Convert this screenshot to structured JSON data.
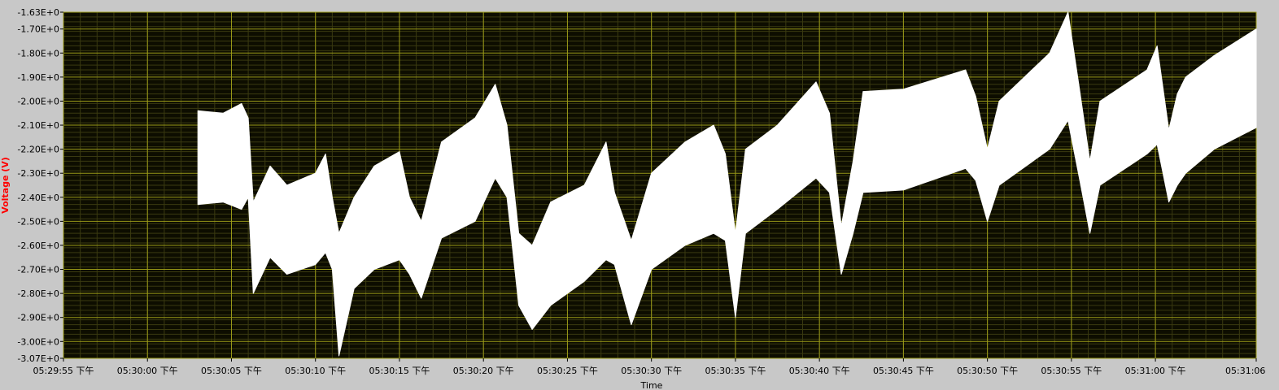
{
  "chart_data": {
    "type": "line",
    "xlabel": "Time",
    "ylabel": "Voltage (V)",
    "xlim": [
      "05:29:55",
      "05:31:06"
    ],
    "ylim": [
      -3.07,
      -1.63
    ],
    "grid": true,
    "yticks": [
      {
        "value": -1.63,
        "label": "-1.63E+0"
      },
      {
        "value": -1.7,
        "label": "-1.70E+0"
      },
      {
        "value": -1.8,
        "label": "-1.80E+0"
      },
      {
        "value": -1.9,
        "label": "-1.90E+0"
      },
      {
        "value": -2.0,
        "label": "-2.00E+0"
      },
      {
        "value": -2.1,
        "label": "-2.10E+0"
      },
      {
        "value": -2.2,
        "label": "-2.20E+0"
      },
      {
        "value": -2.3,
        "label": "-2.30E+0"
      },
      {
        "value": -2.4,
        "label": "-2.40E+0"
      },
      {
        "value": -2.5,
        "label": "-2.50E+0"
      },
      {
        "value": -2.6,
        "label": "-2.60E+0"
      },
      {
        "value": -2.7,
        "label": "-2.70E+0"
      },
      {
        "value": -2.8,
        "label": "-2.80E+0"
      },
      {
        "value": -2.9,
        "label": "-2.90E+0"
      },
      {
        "value": -3.0,
        "label": "-3.00E+0"
      },
      {
        "value": -3.07,
        "label": "-3.07E+0"
      }
    ],
    "xticks": [
      {
        "value": 0,
        "label": "05:29:55 下午"
      },
      {
        "value": 5,
        "label": "05:30:00 下午"
      },
      {
        "value": 10,
        "label": "05:30:05 下午"
      },
      {
        "value": 15,
        "label": "05:30:10 下午"
      },
      {
        "value": 20,
        "label": "05:30:15 下午"
      },
      {
        "value": 25,
        "label": "05:30:20 下午"
      },
      {
        "value": 30,
        "label": "05:30:25 下午"
      },
      {
        "value": 35,
        "label": "05:30:30 下午"
      },
      {
        "value": 40,
        "label": "05:30:35 下午"
      },
      {
        "value": 45,
        "label": "05:30:40 下午"
      },
      {
        "value": 50,
        "label": "05:30:45 下午"
      },
      {
        "value": 55,
        "label": "05:30:50 下午"
      },
      {
        "value": 60,
        "label": "05:30:55 下午"
      },
      {
        "value": 65,
        "label": "05:31:00 下午"
      },
      {
        "value": 71,
        "label": "05:31:06"
      }
    ],
    "series": [
      {
        "color": "#ffffff",
        "band": true,
        "points": [
          {
            "x": 8.0,
            "upper": -2.04,
            "lower": -2.43
          },
          {
            "x": 9.5,
            "upper": -2.05,
            "lower": -2.42
          },
          {
            "x": 10.6,
            "upper": -2.01,
            "lower": -2.45
          },
          {
            "x": 11.0,
            "upper": -2.07,
            "lower": -2.4
          },
          {
            "x": 11.3,
            "upper": -2.42,
            "lower": -2.8
          },
          {
            "x": 12.3,
            "upper": -2.27,
            "lower": -2.65
          },
          {
            "x": 13.3,
            "upper": -2.35,
            "lower": -2.72
          },
          {
            "x": 15.0,
            "upper": -2.3,
            "lower": -2.68
          },
          {
            "x": 15.6,
            "upper": -2.22,
            "lower": -2.63
          },
          {
            "x": 16.0,
            "upper": -2.4,
            "lower": -2.7
          },
          {
            "x": 16.4,
            "upper": -2.55,
            "lower": -3.06
          },
          {
            "x": 17.3,
            "upper": -2.4,
            "lower": -2.78
          },
          {
            "x": 18.5,
            "upper": -2.27,
            "lower": -2.7
          },
          {
            "x": 20.0,
            "upper": -2.21,
            "lower": -2.66
          },
          {
            "x": 20.6,
            "upper": -2.4,
            "lower": -2.72
          },
          {
            "x": 21.3,
            "upper": -2.5,
            "lower": -2.82
          },
          {
            "x": 22.5,
            "upper": -2.17,
            "lower": -2.57
          },
          {
            "x": 24.5,
            "upper": -2.07,
            "lower": -2.5
          },
          {
            "x": 25.7,
            "upper": -1.93,
            "lower": -2.32
          },
          {
            "x": 26.4,
            "upper": -2.1,
            "lower": -2.4
          },
          {
            "x": 27.1,
            "upper": -2.55,
            "lower": -2.85
          },
          {
            "x": 27.9,
            "upper": -2.6,
            "lower": -2.95
          },
          {
            "x": 29.0,
            "upper": -2.42,
            "lower": -2.85
          },
          {
            "x": 31.0,
            "upper": -2.35,
            "lower": -2.75
          },
          {
            "x": 32.3,
            "upper": -2.17,
            "lower": -2.66
          },
          {
            "x": 32.8,
            "upper": -2.38,
            "lower": -2.68
          },
          {
            "x": 33.8,
            "upper": -2.58,
            "lower": -2.93
          },
          {
            "x": 35.0,
            "upper": -2.3,
            "lower": -2.7
          },
          {
            "x": 37.0,
            "upper": -2.17,
            "lower": -2.6
          },
          {
            "x": 38.7,
            "upper": -2.1,
            "lower": -2.55
          },
          {
            "x": 39.4,
            "upper": -2.22,
            "lower": -2.58
          },
          {
            "x": 40.0,
            "upper": -2.55,
            "lower": -2.9
          },
          {
            "x": 40.6,
            "upper": -2.2,
            "lower": -2.55
          },
          {
            "x": 42.5,
            "upper": -2.1,
            "lower": -2.45
          },
          {
            "x": 44.8,
            "upper": -1.92,
            "lower": -2.32
          },
          {
            "x": 45.6,
            "upper": -2.05,
            "lower": -2.38
          },
          {
            "x": 46.3,
            "upper": -2.52,
            "lower": -2.72
          },
          {
            "x": 47.0,
            "upper": -2.25,
            "lower": -2.55
          },
          {
            "x": 47.6,
            "upper": -1.96,
            "lower": -2.38
          },
          {
            "x": 50.0,
            "upper": -1.95,
            "lower": -2.37
          },
          {
            "x": 53.7,
            "upper": -1.87,
            "lower": -2.28
          },
          {
            "x": 54.3,
            "upper": -1.98,
            "lower": -2.33
          },
          {
            "x": 55.0,
            "upper": -2.2,
            "lower": -2.5
          },
          {
            "x": 55.7,
            "upper": -2.0,
            "lower": -2.35
          },
          {
            "x": 58.7,
            "upper": -1.8,
            "lower": -2.2
          },
          {
            "x": 59.8,
            "upper": -1.63,
            "lower": -2.08
          },
          {
            "x": 60.5,
            "upper": -1.96,
            "lower": -2.33
          },
          {
            "x": 61.1,
            "upper": -2.25,
            "lower": -2.55
          },
          {
            "x": 61.7,
            "upper": -2.0,
            "lower": -2.35
          },
          {
            "x": 64.5,
            "upper": -1.87,
            "lower": -2.22
          },
          {
            "x": 65.1,
            "upper": -1.77,
            "lower": -2.18
          },
          {
            "x": 65.8,
            "upper": -2.12,
            "lower": -2.42
          },
          {
            "x": 66.3,
            "upper": -1.97,
            "lower": -2.35
          },
          {
            "x": 66.8,
            "upper": -1.9,
            "lower": -2.3
          },
          {
            "x": 68.5,
            "upper": -1.81,
            "lower": -2.2
          },
          {
            "x": 71.0,
            "upper": -1.7,
            "lower": -2.11
          }
        ]
      }
    ]
  }
}
